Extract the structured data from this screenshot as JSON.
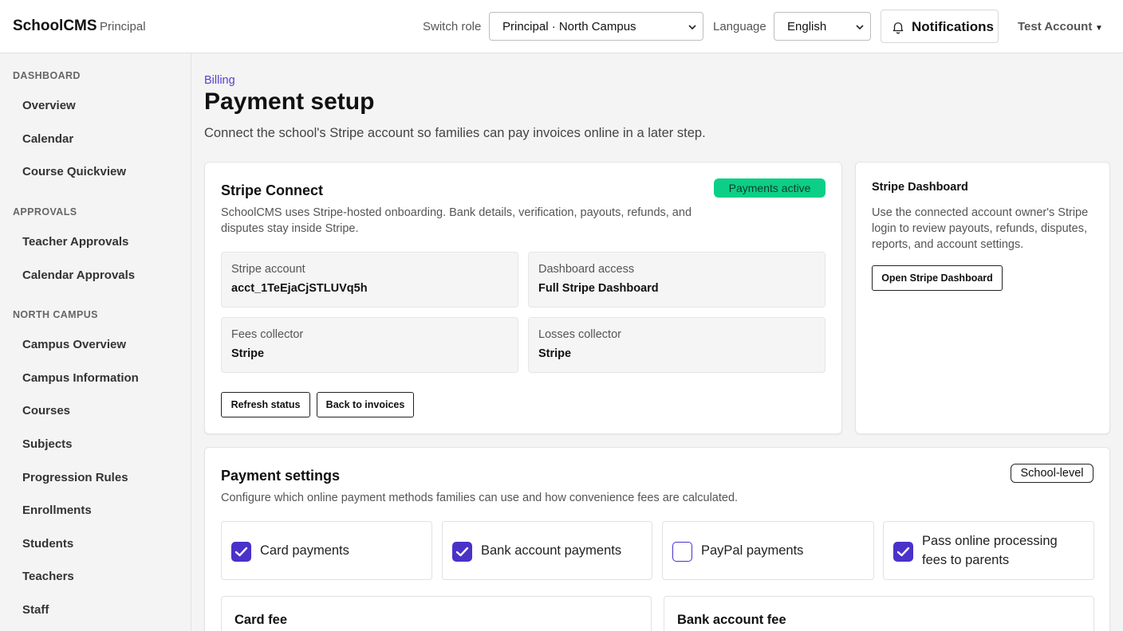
{
  "header": {
    "brand": "SchoolCMS",
    "role_tag": "Principal",
    "switch_role_label": "Switch role",
    "switch_role_value": "Principal · North Campus",
    "language_label": "Language",
    "language_value": "English",
    "notifications_label": "Notifications",
    "account_name": "Test Account"
  },
  "sidebar": {
    "sections": [
      {
        "title": "DASHBOARD",
        "items": [
          "Overview",
          "Calendar",
          "Course Quickview"
        ]
      },
      {
        "title": "APPROVALS",
        "items": [
          "Teacher Approvals",
          "Calendar Approvals"
        ]
      },
      {
        "title": "NORTH CAMPUS",
        "items": [
          "Campus Overview",
          "Campus Information",
          "Courses",
          "Subjects",
          "Progression Rules",
          "Enrollments",
          "Students",
          "Teachers",
          "Staff"
        ]
      }
    ]
  },
  "main": {
    "breadcrumb": "Billing",
    "title": "Payment setup",
    "subtitle": "Connect the school's Stripe account so families can pay invoices online in a later step."
  },
  "stripe_connect": {
    "title": "Stripe Connect",
    "status_badge": "Payments active",
    "description": "SchoolCMS uses Stripe-hosted onboarding. Bank details, verification, payouts, refunds, and disputes stay inside Stripe.",
    "fields": [
      {
        "label": "Stripe account",
        "value": "acct_1TeEjaCjSTLUVq5h"
      },
      {
        "label": "Dashboard access",
        "value": "Full Stripe Dashboard"
      },
      {
        "label": "Fees collector",
        "value": "Stripe"
      },
      {
        "label": "Losses collector",
        "value": "Stripe"
      }
    ],
    "refresh_button": "Refresh status",
    "back_button": "Back to invoices"
  },
  "stripe_dashboard": {
    "title": "Stripe Dashboard",
    "description": "Use the connected account owner's Stripe login to review payouts, refunds, disputes, reports, and account settings.",
    "open_button": "Open Stripe Dashboard"
  },
  "payment_settings": {
    "title": "Payment settings",
    "scope_badge": "School-level",
    "description": "Configure which online payment methods families can use and how convenience fees are calculated.",
    "options": [
      {
        "label": "Card payments",
        "checked": true
      },
      {
        "label": "Bank account payments",
        "checked": true
      },
      {
        "label": "PayPal payments",
        "checked": false
      },
      {
        "label": "Pass online processing fees to parents",
        "checked": true
      }
    ],
    "card_fee_title": "Card fee",
    "bank_fee_title": "Bank account fee"
  },
  "colors": {
    "accent": "#4a32c9",
    "link": "#5a3fd0",
    "success": "#0ccf87"
  }
}
